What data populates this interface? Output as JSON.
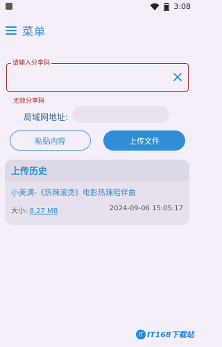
{
  "status": {
    "time": "3:08"
  },
  "topbar": {
    "title": "菜单",
    "menu_icon": "menu-icon"
  },
  "share": {
    "legend": "请输入分享码",
    "value": "",
    "error": "无效分享码"
  },
  "lan": {
    "label": "局域网地址:",
    "value": ""
  },
  "buttons": {
    "paste": "粘贴内容",
    "upload": "上传文件"
  },
  "history": {
    "heading": "上传历史",
    "items": [
      {
        "title": "小美满-《热辣滚烫》电影热辣陪伴曲",
        "size_label": "大小:",
        "size_value": "8.27 MB",
        "datetime": "2024-09-06 15:05:17"
      }
    ]
  },
  "watermark": {
    "logo": "IT",
    "text": "IT168下载站"
  },
  "colors": {
    "accent": "#2e8fd6",
    "error": "#b42a2a",
    "background": "#f3eef7"
  }
}
